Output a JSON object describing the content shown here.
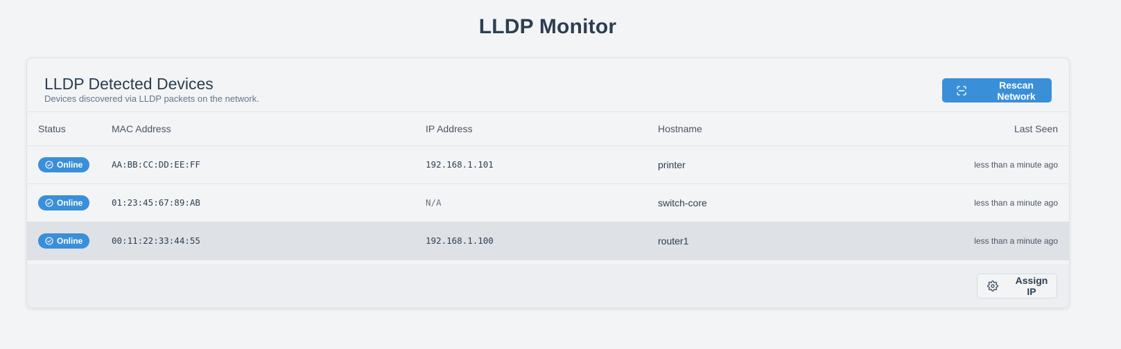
{
  "page": {
    "title": "LLDP Monitor"
  },
  "card": {
    "title": "LLDP Detected Devices",
    "subtitle": "Devices discovered via LLDP packets on the network.",
    "rescan_label": "Rescan Network"
  },
  "table": {
    "columns": [
      "Status",
      "MAC Address",
      "IP Address",
      "Hostname",
      "Last Seen"
    ],
    "rows": [
      {
        "status": "Online",
        "mac": "AA:BB:CC:DD:EE:FF",
        "ip": "192.168.1.101",
        "hostname": "printer",
        "last_seen": "less than a minute ago"
      },
      {
        "status": "Online",
        "mac": "01:23:45:67:89:AB",
        "ip": "N/A",
        "hostname": "switch-core",
        "last_seen": "less than a minute ago"
      },
      {
        "status": "Online",
        "mac": "00:11:22:33:44:55",
        "ip": "192.168.1.100",
        "hostname": "router1",
        "last_seen": "less than a minute ago"
      }
    ]
  },
  "footer": {
    "assign_label": "Assign IP"
  },
  "icons": {
    "rescan": "scan-icon",
    "status": "check-circle-icon",
    "assign": "gear-icon"
  },
  "colors": {
    "accent": "#3a8fd9",
    "background": "#f3f4f6",
    "text": "#2c3e50",
    "selected_row": "#dee1e6"
  }
}
